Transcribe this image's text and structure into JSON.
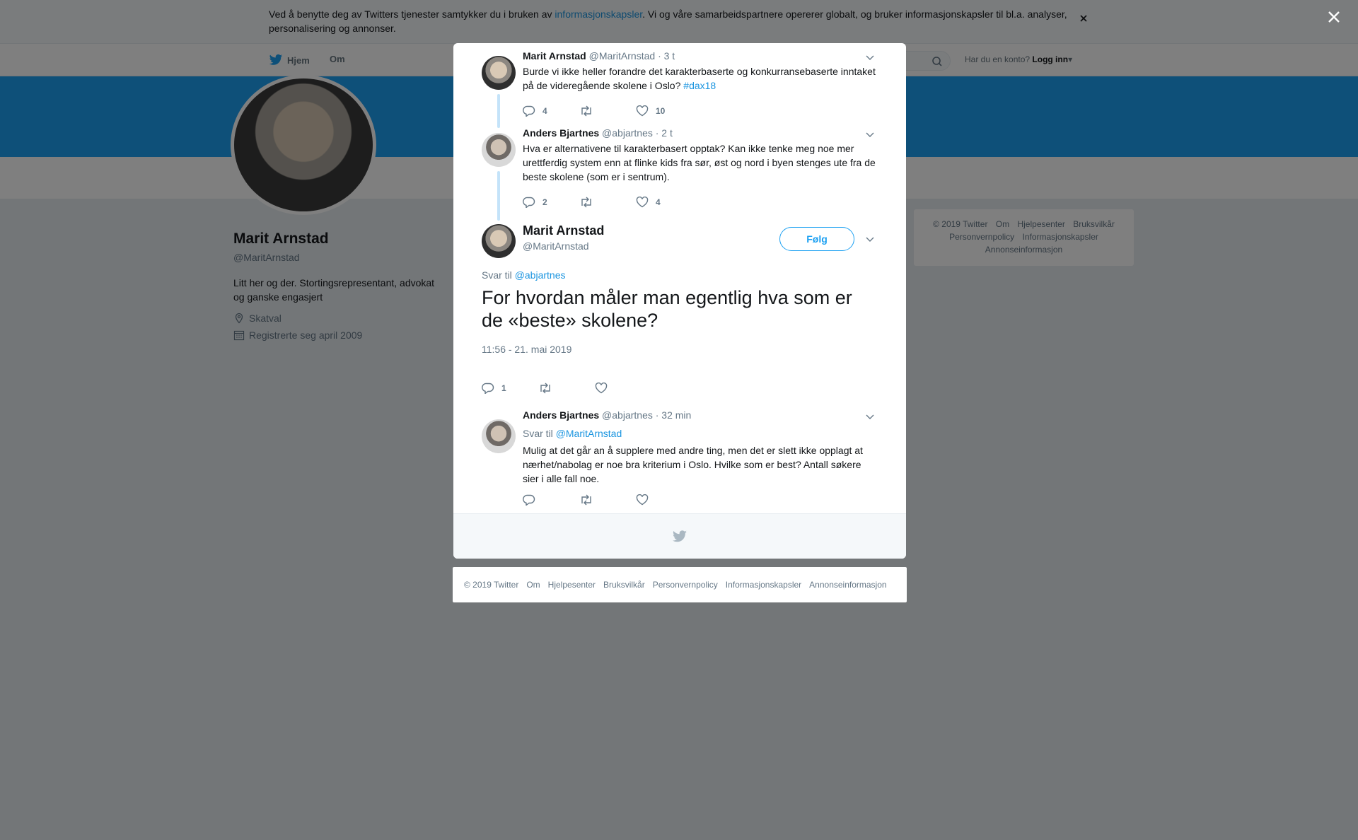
{
  "cookie": {
    "text_before": "Ved å benytte deg av Twitters tjenester samtykker du i bruken av ",
    "link": "informasjonskapsler",
    "text_after": ". Vi og våre samarbeidspartnere opererer globalt, og bruker informasjonskapsler til bl.a. analyser, personalisering og annonser."
  },
  "nav": {
    "home": "Hjem",
    "about": "Om",
    "login_prompt": "Har du en konto?",
    "login_label": "Logg inn"
  },
  "profile": {
    "name": "Marit Arnstad",
    "handle": "@MaritArnstad",
    "bio": "Litt her og der. Stortingsrepresentant, advokat og ganske engasjert",
    "location": "Skatval",
    "joined": "Registrerte seg april 2009"
  },
  "side_footer": {
    "links": [
      "© 2019 Twitter",
      "Om",
      "Hjelpesenter",
      "Bruksvilkår",
      "Personvernpolicy",
      "Informasjonskapsler",
      "Annonseinformasjon"
    ]
  },
  "thread": {
    "tweet1": {
      "name": "Marit Arnstad",
      "handle": "@MaritArnstad",
      "time": "· 3 t",
      "text": "Burde vi ikke heller forandre det karakterbaserte og konkurransebaserte inntaket på de videregående skolene i Oslo? ",
      "hashtag": "#dax18",
      "replies": "4",
      "likes": "10"
    },
    "tweet2": {
      "name": "Anders Bjartnes",
      "handle": "@abjartnes",
      "time": "· 2 t",
      "text": "Hva er alternativene til karakterbasert opptak? Kan ikke tenke meg noe mer urettferdig system enn at flinke kids fra sør, øst og nord i byen stenges ute fra de beste skolene (som er i sentrum).",
      "replies": "2",
      "likes": "4"
    },
    "main": {
      "name": "Marit Arnstad",
      "handle": "@MaritArnstad",
      "follow": "Følg",
      "reply_prefix": "Svar til",
      "reply_to": "@abjartnes",
      "text": "For hvordan måler man egentlig hva som er de «beste» skolene?",
      "timestamp": "11:56 - 21. mai 2019",
      "replies": "1"
    },
    "reply": {
      "name": "Anders Bjartnes",
      "handle": "@abjartnes",
      "time": "· 32 min",
      "reply_prefix": "Svar til",
      "reply_to": "@MaritArnstad",
      "text": "Mulig at det går an å supplere med andre ting, men det er slett ikke opplagt at nærhet/nabolag er noe bra kriterium i Oslo. Hvilke som er best? Antall søkere sier i alle fall noe."
    }
  },
  "bottom_footer": {
    "links": [
      "© 2019 Twitter",
      "Om",
      "Hjelpesenter",
      "Bruksvilkår",
      "Personvernpolicy",
      "Informasjonskapsler",
      "Annonseinformasjon"
    ]
  },
  "colors": {
    "accent": "#1da1f2",
    "link": "#1b95e0",
    "overlay": "rgba(0,0,0,0.5)"
  }
}
